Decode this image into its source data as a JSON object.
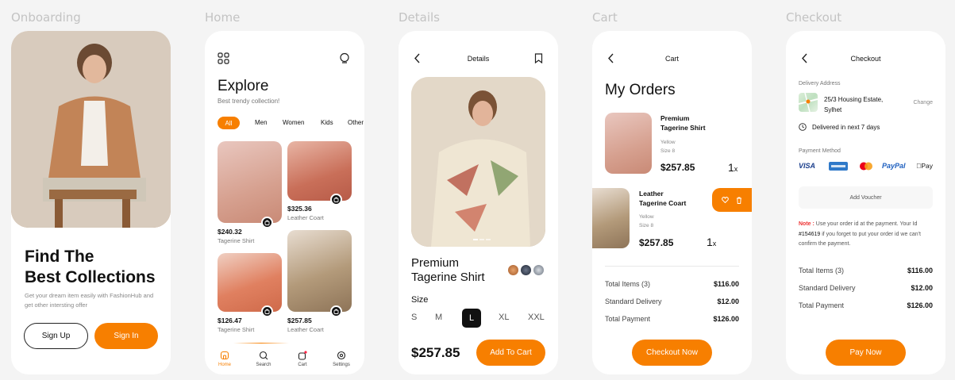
{
  "screens": {
    "onboarding": "Onboarding",
    "home": "Home",
    "details": "Details",
    "cart": "Cart",
    "checkout": "Checkout"
  },
  "onboarding": {
    "title_line1": "Find The",
    "title_line2": "Best Collections",
    "subtitle": "Get your dream item easily with FashionHub and get other intersting offer",
    "signup": "Sign Up",
    "signin": "Sign In"
  },
  "home": {
    "title": "Explore",
    "subtitle": "Best trendy collection!",
    "categories": [
      "All",
      "Men",
      "Women",
      "Kids",
      "Other"
    ],
    "products": [
      {
        "price": "$240.32",
        "name": "Tagerine Shirt"
      },
      {
        "price": "$325.36",
        "name": "Leather Coart"
      },
      {
        "price": "$126.47",
        "name": "Tagerine Shirt"
      },
      {
        "price": "$257.85",
        "name": "Leather Coart"
      }
    ],
    "nav": [
      "Home",
      "Search",
      "Cart",
      "Settings"
    ]
  },
  "details": {
    "header": "Details",
    "name_line1": "Premium",
    "name_line2": "Tagerine Shirt",
    "size_label": "Size",
    "sizes": [
      "S",
      "M",
      "L",
      "XL",
      "XXL"
    ],
    "selected_size": "L",
    "price": "$257.85",
    "add_to_cart": "Add To Cart"
  },
  "cart": {
    "header": "Cart",
    "title": "My Orders",
    "items": [
      {
        "name_line1": "Premium",
        "name_line2": "Tagerine Shirt",
        "color": "Yellow",
        "size": "Size 8",
        "price": "$257.85",
        "qty": "1",
        "qty_x": "x"
      },
      {
        "name_line1": "Leather",
        "name_line2": "Tagerine Coart",
        "color": "Yellow",
        "size": "Size 8",
        "price": "$257.85",
        "qty": "1",
        "qty_x": "x"
      }
    ],
    "totals": [
      {
        "label": "Total Items (3)",
        "value": "$116.00"
      },
      {
        "label": "Standard Delivery",
        "value": "$12.00"
      },
      {
        "label": "Total Payment",
        "value": "$126.00"
      }
    ],
    "checkout": "Checkout Now"
  },
  "checkout": {
    "header": "Checkout",
    "delivery_label": "Delivery Address",
    "address_line1": "25/3 Housing Estate,",
    "address_line2": "Sylhet",
    "change": "Change",
    "delivery_time": "Delivered in next 7 days",
    "payment_label": "Payment Method",
    "payment_methods": [
      "VISA",
      "AMEX",
      "Mastercard",
      "PayPal",
      "Apple Pay"
    ],
    "visa": "VISA",
    "paypal": "PayPal",
    "applepay": "Pay",
    "voucher": "Add Voucher",
    "note_label": "Note :",
    "note_text1": " Use your order id at the payment. Your Id ",
    "note_id": "#154619",
    "note_text2": " if you forget to put your order id we can't confirm the payment.",
    "totals": [
      {
        "label": "Total Items (3)",
        "value": "$116.00"
      },
      {
        "label": "Standard Delivery",
        "value": "$12.00"
      },
      {
        "label": "Total Payment",
        "value": "$126.00"
      }
    ],
    "pay": "Pay Now"
  },
  "colors": {
    "accent": "#f77f00",
    "background": "#f4f4f4",
    "card": "#ffffff"
  }
}
